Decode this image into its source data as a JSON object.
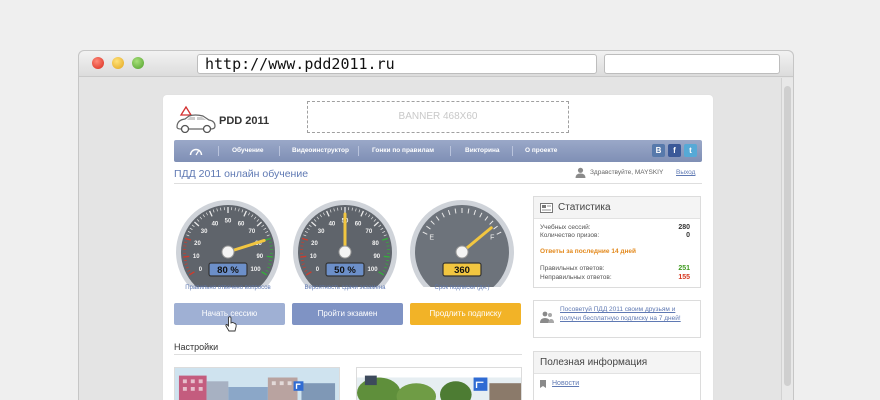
{
  "browser": {
    "url": "http://www.pdd2011.ru"
  },
  "site": {
    "logo_text": "PDD 2011",
    "banner": "BANNER 468X60"
  },
  "nav": {
    "items": [
      "Обучение",
      "Видеоинструктор",
      "Гонки по правилам",
      "Викторина",
      "О проекте"
    ],
    "social": [
      "В",
      "f",
      "t"
    ]
  },
  "header": {
    "title": "ПДД 2011 онлайн обучение",
    "greeting": "Здравствуйте, MAYSKIY",
    "logout": "Выход"
  },
  "gauges": [
    {
      "value": "80 %",
      "caption": "Правильно отвечено вопросов",
      "level": 0.8,
      "ticks": [
        "0",
        "10",
        "20",
        "30",
        "40",
        "50",
        "60",
        "70",
        "80",
        "90",
        "100"
      ]
    },
    {
      "value": "50 %",
      "caption": "Вероятность сдачи экзамена",
      "level": 0.5,
      "ticks": [
        "0",
        "10",
        "20",
        "30",
        "40",
        "50",
        "60",
        "70",
        "80",
        "90",
        "100"
      ]
    },
    {
      "value": "360",
      "caption": "Срок подписки (дн.)",
      "level": 0.9,
      "ticks": [
        "E",
        "F"
      ]
    }
  ],
  "buttons": {
    "start": "Начать сессию",
    "exam": "Пройти экзамен",
    "renew": "Продлить подписку"
  },
  "settings": {
    "title": "Настройки"
  },
  "stats": {
    "title": "Статистика",
    "sessions_label": "Учебных сессий:",
    "sessions_value": "280",
    "prizes_label": "Количество призов:",
    "prizes_value": "0",
    "recent_label": "Ответы за последние 14 дней",
    "correct_label": "Правильных ответов:",
    "correct_value": "251",
    "wrong_label": "Неправильных ответов:",
    "wrong_value": "155"
  },
  "promo": {
    "text": "Посоветуй ПДД 2011 своим друзьям и получи бесплатную подписку на 7 дней!"
  },
  "info": {
    "title": "Полезная информация",
    "items": [
      "Новости"
    ]
  },
  "colors": {
    "accent": "#5f79b3",
    "nav": "#8795bb",
    "renew": "#f2b327",
    "correct": "#3f9a1f",
    "wrong": "#d6361e",
    "recent": "#e38a1e"
  }
}
